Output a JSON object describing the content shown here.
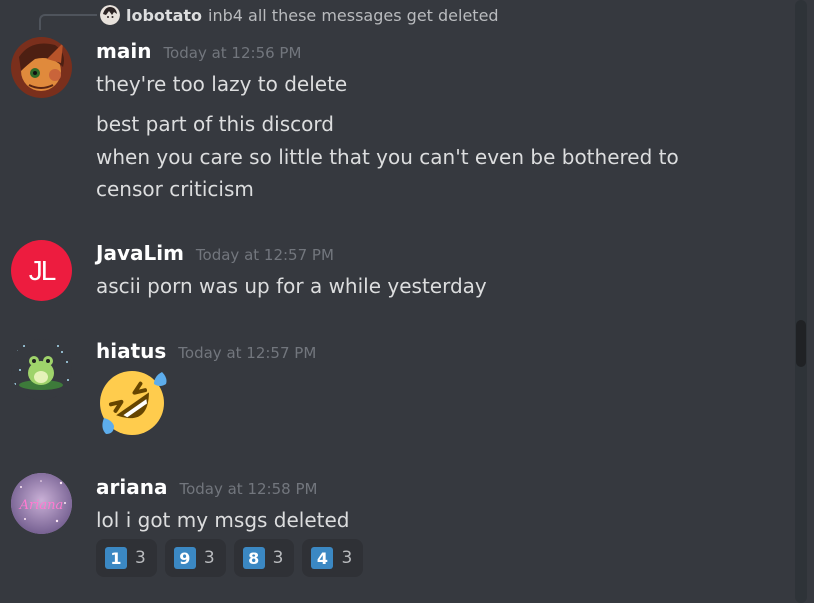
{
  "reply": {
    "author": "lobotato",
    "text": "inb4 all these messages get deleted"
  },
  "messages": [
    {
      "author": "main",
      "timestamp": "Today at 12:56 PM",
      "lines": [
        "they're too lazy to delete",
        "best part of this discord",
        "when you care so little that you can't even be bothered to",
        "censor criticism"
      ]
    },
    {
      "author": "JavaLim",
      "timestamp": "Today at 12:57 PM",
      "avatar_text": "JL",
      "avatar_color": "#ed1c3f",
      "lines": [
        "ascii porn was up for a while yesterday"
      ]
    },
    {
      "author": "hiatus",
      "timestamp": "Today at 12:57 PM",
      "emoji": "rolling-on-floor-laughing"
    },
    {
      "author": "ariana",
      "timestamp": "Today at 12:58 PM",
      "avatar_text": "Ariana",
      "lines": [
        "lol i got my msgs deleted"
      ],
      "reactions": [
        {
          "emoji": "1",
          "count": "3"
        },
        {
          "emoji": "9",
          "count": "3"
        },
        {
          "emoji": "8",
          "count": "3"
        },
        {
          "emoji": "4",
          "count": "3"
        }
      ]
    }
  ],
  "colors": {
    "background": "#36393f",
    "keycap": "#3b88c3",
    "timestamp": "#72767d"
  }
}
